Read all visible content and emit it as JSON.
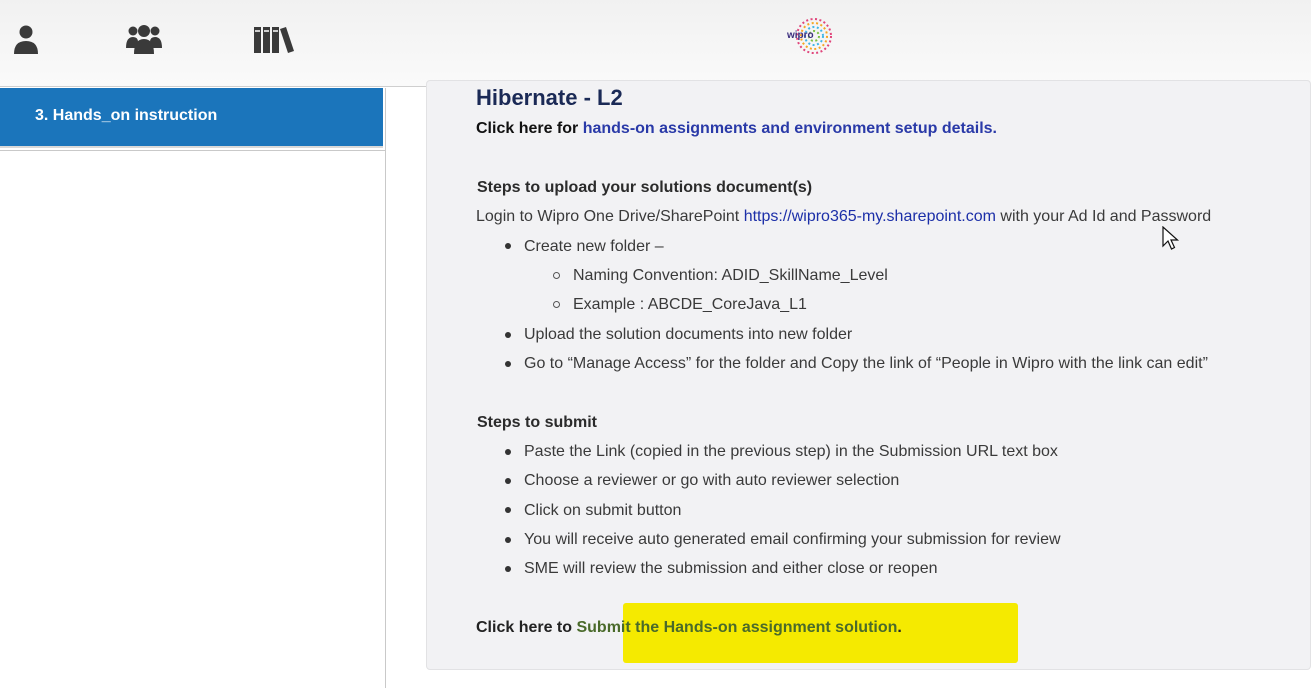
{
  "header": {
    "nav_icons": [
      "user-icon",
      "group-icon",
      "library-icon"
    ],
    "logo_text": "wipro"
  },
  "sidebar": {
    "items": [
      {
        "label": "3. Hands_on instruction",
        "active": true
      }
    ]
  },
  "main": {
    "title": "Hibernate - L2",
    "intro_prefix": "Click here for ",
    "intro_link": "hands-on assignments and environment setup details.",
    "upload_section": {
      "title": "Steps to upload your solutions document(s)",
      "login_prefix": "Login to Wipro One Drive/SharePoint ",
      "login_link": "https://wipro365-my.sharepoint.com",
      "login_suffix": " with your Ad Id and Password",
      "bullets": [
        "Create new folder –",
        "Upload the solution documents into new folder",
        "Go to “Manage Access” for the folder and Copy the link of “People in Wipro with the link can edit”"
      ],
      "sub_bullets": [
        "Naming Convention: ADID_SkillName_Level",
        "Example : ABCDE_CoreJava_L1"
      ]
    },
    "submit_section": {
      "title": "Steps to submit",
      "bullets": [
        "Paste the Link (copied in the previous step) in the Submission URL text box",
        "Choose a reviewer or go with auto reviewer selection",
        "Click on submit button",
        "You will receive auto generated email confirming your submission for review",
        "SME will review the submission and either close or reopen"
      ]
    },
    "submit_prefix": "Click here to ",
    "submit_link": "Submit the Hands-on assignment solution",
    "submit_suffix": ".",
    "highlight_color": "#f5ea00",
    "accent_color": "#1b75bb"
  }
}
